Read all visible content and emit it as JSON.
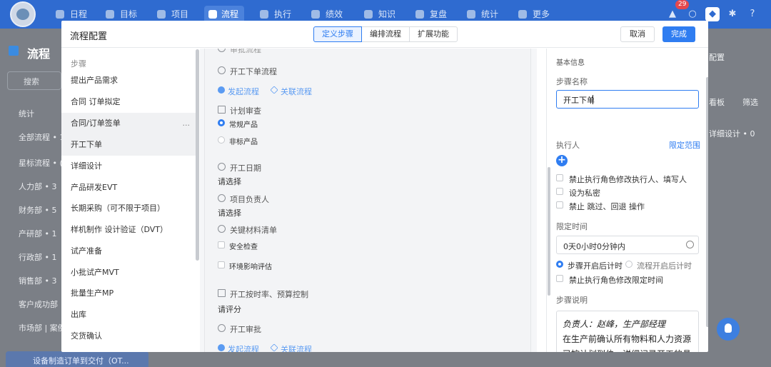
{
  "topnav": {
    "items": [
      "日程",
      "目标",
      "项目",
      "流程",
      "执行",
      "绩效",
      "知识",
      "复盘",
      "统计",
      "更多"
    ],
    "active_index": 3,
    "notification_count": "29"
  },
  "background": {
    "page_title": "流程",
    "search_placeholder": "搜索",
    "stats_label": "统计",
    "all_flows": "全部流程 • 1",
    "sidebar_groups": [
      "星标流程 • (",
      "人力部 • 3",
      "财务部 • 5",
      "产研部 • 1",
      "行政部 • 1",
      "销售部 • 3",
      "客户成功部",
      "市场部 | 案例"
    ],
    "right_texts": [
      "配置",
      "看板",
      "筛选",
      "详细设计 • 0"
    ],
    "bottom_item": "设备制造订单到交付（OT..."
  },
  "modal": {
    "title": "流程配置",
    "tabs": [
      "定义步骤",
      "编排流程",
      "扩展功能"
    ],
    "active_tab": 0,
    "cancel_label": "取消",
    "done_label": "完成",
    "steps_header": "步骤",
    "steps": [
      "提出产品需求",
      "合同 订单拟定",
      "合同/订单签单",
      "开工下单",
      "详细设计",
      "产品研发EVT",
      "长期采购（可不限于项目）",
      "样机制作 设计验证（DVT）",
      "试产准备",
      "小批试产MVT",
      "批量生产MP",
      "出库",
      "交货确认"
    ],
    "hover_step": 2,
    "selected_step": 3,
    "step_more": "...",
    "form": {
      "top_cut_label": "审批流程",
      "start_flow_section": "开工下单流程",
      "start_flow_link": "发起流程",
      "link_flow_link": "关联流程",
      "plan_review": "计划审查",
      "plan_options": [
        "常规产品",
        "非标产品"
      ],
      "plan_selected": 0,
      "start_date": "开工日期",
      "start_date_value": "请选择",
      "project_owner": "项目负责人",
      "project_owner_value": "请选择",
      "material_list": "关键材料清单",
      "material_options": [
        "安全检查",
        "环境影响评估"
      ],
      "on_time_section": "开工按时率、预算控制",
      "on_time_value": "请评分",
      "approval_section": "开工审批",
      "approval_start_link": "发起流程",
      "approval_link_link": "关联流程"
    },
    "settings": {
      "header": "基本信息",
      "step_name_label": "步骤名称",
      "step_name_value": "开工下单",
      "executor_label": "执行人",
      "scope_link": "限定范围",
      "executor_options": [
        "禁止执行角色修改执行人、填写人",
        "设为私密",
        "禁止 跳过、回退 操作"
      ],
      "time_limit_label": "限定时间",
      "time_limit_value": "0天0小时0分钟内",
      "timer_options": [
        "步骤开启后计时",
        "流程开启后计时"
      ],
      "timer_selected": 0,
      "timer_lock_option": "禁止执行角色修改限定时间",
      "desc_label": "步骤说明",
      "desc_owner": "负责人：赵峰，生产部经理",
      "desc_body": "在生产前确认所有物料和人力资源已按计划到位。详细记录开工的具体日期和相关的前置条件，确保所"
    }
  }
}
